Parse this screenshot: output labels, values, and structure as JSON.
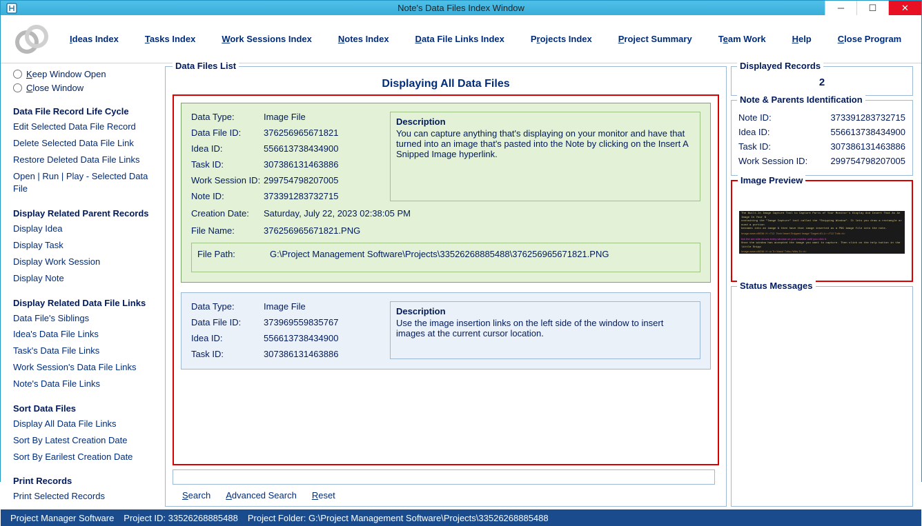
{
  "window": {
    "title": "Note's Data Files Index Window"
  },
  "menu": {
    "items": [
      "Ideas Index",
      "Tasks Index",
      "Work Sessions Index",
      "Notes Index",
      "Data File Links Index",
      "Projects Index",
      "Project Summary",
      "Team Work",
      "Help",
      "Close Program"
    ]
  },
  "radios": {
    "keep": "Keep Window Open",
    "close": "Close Window"
  },
  "left": {
    "sec1_hdr": "Data File Record Life Cycle",
    "sec1": [
      "Edit Selected Data File Record",
      "Delete Selected Data File Link",
      "Restore Deleted Data File Links",
      "Open | Run | Play - Selected Data File"
    ],
    "sec2_hdr": "Display Related Parent Records",
    "sec2": [
      "Display Idea",
      "Display Task",
      "Display Work Session",
      "Display Note"
    ],
    "sec3_hdr": "Display Related Data File Links",
    "sec3": [
      "Data File's Siblings",
      "Idea's Data File Links",
      "Task's Data File Links",
      "Work Session's Data File Links",
      "Note's Data File Links"
    ],
    "sec4_hdr": "Sort Data Files",
    "sec4": [
      "Display All Data File Links",
      "Sort By Latest Creation Date",
      "Sort By Earilest Creation Date"
    ],
    "sec5_hdr": "Print Records",
    "sec5": [
      "Print Selected Records"
    ]
  },
  "center": {
    "fieldset_title": "Data Files List",
    "list_title": "Displaying All Data Files",
    "labels": {
      "data_type": "Data Type:",
      "data_file_id": "Data File ID:",
      "idea_id": "Idea ID:",
      "task_id": "Task ID:",
      "ws_id": "Work Session ID:",
      "note_id": "Note ID:",
      "creation": "Creation Date:",
      "filename": "File Name:",
      "filepath": "File Path:",
      "description": "Description"
    },
    "record1": {
      "data_type": "Image File",
      "data_file_id": "376256965671821",
      "idea_id": "556613738434900",
      "task_id": "307386131463886",
      "ws_id": "299754798207005",
      "note_id": "373391283732715",
      "creation": "Saturday, July 22, 2023   02:38:05 PM",
      "filename": "376256965671821.PNG",
      "filepath": "G:\\Project Management Software\\Projects\\33526268885488\\376256965671821.PNG",
      "description": "You can capture anything that's displaying on your monitor and have that turned into an image that's pasted into the Note by clicking on the Insert A Snipped Image hyperlink."
    },
    "record2": {
      "data_type": "Image File",
      "data_file_id": "373969559835767",
      "idea_id": "556613738434900",
      "task_id": "307386131463886",
      "description": "Use the image insertion links on the left side of the window to insert images at the current cursor location."
    },
    "search": {
      "s": "Search",
      "adv": "Advanced Search",
      "reset": "Reset"
    }
  },
  "right": {
    "disp_hdr": "Displayed Records",
    "count": "2",
    "ident_hdr": "Note & Parents Identification",
    "ids": {
      "note_lbl": "Note ID:",
      "note": "373391283732715",
      "idea_lbl": "Idea ID:",
      "idea": "556613738434900",
      "task_lbl": "Task ID:",
      "task": "307386131463886",
      "ws_lbl": "Work Session ID:",
      "ws": "299754798207005"
    },
    "preview_hdr": "Image Preview",
    "status_hdr": "Status Messages"
  },
  "status": {
    "app": "Project Manager Software",
    "pid_lbl": "Project ID:",
    "pid": "33526268885488",
    "pfolder_lbl": "Project Folder:",
    "pfolder": "G:\\Project Management Software\\Projects\\33526268885488"
  }
}
